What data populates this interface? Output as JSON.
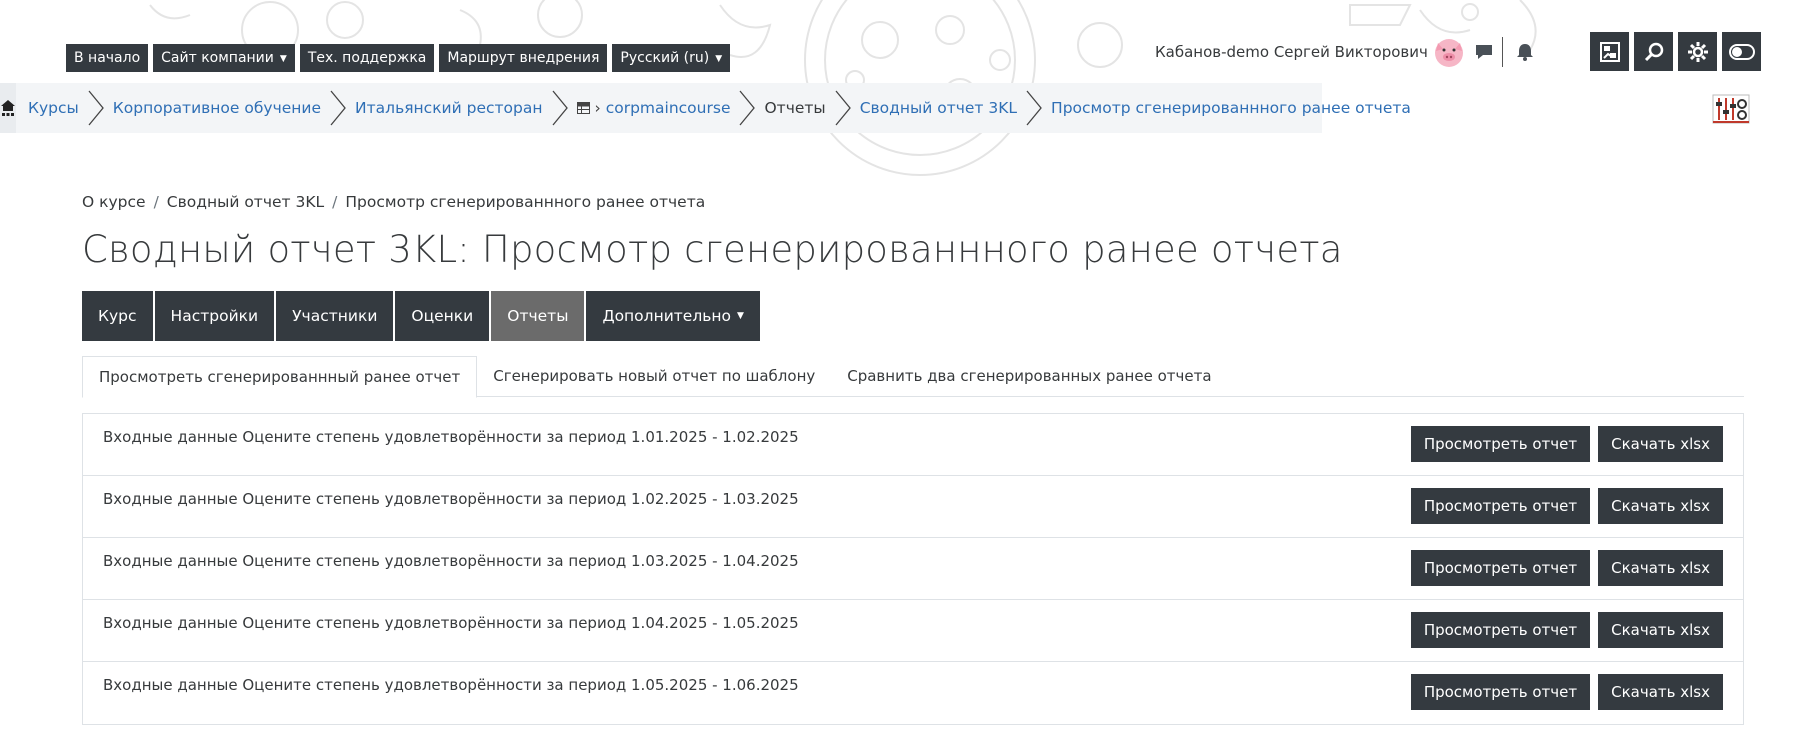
{
  "topnav": {
    "items": [
      {
        "label": "В начало",
        "dropdown": false
      },
      {
        "label": "Сайт компании",
        "dropdown": true
      },
      {
        "label": "Тех. поддержка",
        "dropdown": false
      },
      {
        "label": "Маршрут внедрения",
        "dropdown": false
      },
      {
        "label": "Русский (ru)",
        "dropdown": true
      }
    ]
  },
  "user": {
    "name": "Кабанов-demo Сергей Викторович",
    "icons": [
      "pig-avatar-icon",
      "chat-icon",
      "bell-icon"
    ]
  },
  "toolbar": {
    "icons": [
      "dashboard-icon",
      "search-icon",
      "gear-icon",
      "toggle-icon"
    ]
  },
  "breadcrumb": {
    "items": [
      {
        "label": "Курсы",
        "link": true
      },
      {
        "label": "Корпоративное обучение",
        "link": true
      },
      {
        "label": "Итальянский ресторан",
        "link": true
      },
      {
        "label": "corpmaincourse",
        "link": true,
        "icon": "course-table-icon"
      },
      {
        "label": "Отчеты",
        "link": false
      },
      {
        "label": "Сводный отчет 3KL",
        "link": true
      },
      {
        "label": "Просмотр сгенерированнного ранее отчета",
        "link": true
      }
    ]
  },
  "page_crumb": {
    "items": [
      "О курсе",
      "Сводный отчет 3KL",
      "Просмотр сгенерированнного ранее отчета"
    ],
    "separator": "/"
  },
  "page_title": "Сводный отчет 3KL: Просмотр сгенерированнного ранее отчета",
  "course_tabs": [
    {
      "label": "Курс",
      "active": false
    },
    {
      "label": "Настройки",
      "active": false
    },
    {
      "label": "Участники",
      "active": false
    },
    {
      "label": "Оценки",
      "active": false
    },
    {
      "label": "Отчеты",
      "active": true
    },
    {
      "label": "Дополнительно",
      "active": false,
      "dropdown": true
    }
  ],
  "sub_tabs": [
    {
      "label": "Просмотреть сгенерированнный ранее отчет",
      "active": true
    },
    {
      "label": "Сгенерировать новый отчет по шаблону",
      "active": false
    },
    {
      "label": "Сравнить два сгенерированных ранее отчета",
      "active": false
    }
  ],
  "reports": [
    {
      "text": "Входные данные Оцените степень удовлетворённости за период 1.01.2025 - 1.02.2025",
      "view_label": "Просмотреть отчет",
      "download_label": "Скачать xlsx"
    },
    {
      "text": "Входные данные Оцените степень удовлетворённости за период 1.02.2025 - 1.03.2025",
      "view_label": "Просмотреть отчет",
      "download_label": "Скачать xlsx"
    },
    {
      "text": "Входные данные Оцените степень удовлетворённости за период 1.03.2025 - 1.04.2025",
      "view_label": "Просмотреть отчет",
      "download_label": "Скачать xlsx"
    },
    {
      "text": "Входные данные Оцените степень удовлетворённости за период 1.04.2025 - 1.05.2025",
      "view_label": "Просмотреть отчет",
      "download_label": "Скачать xlsx"
    },
    {
      "text": "Входные данные Оцените степень удовлетворённости за период 1.05.2025 - 1.06.2025",
      "view_label": "Просмотреть отчет",
      "download_label": "Скачать xlsx"
    }
  ],
  "colors": {
    "dark": "#343a40",
    "active_tab": "#6b6b6b",
    "link": "#2f6fb5",
    "text": "#373a3c",
    "border": "#dee2e6"
  }
}
